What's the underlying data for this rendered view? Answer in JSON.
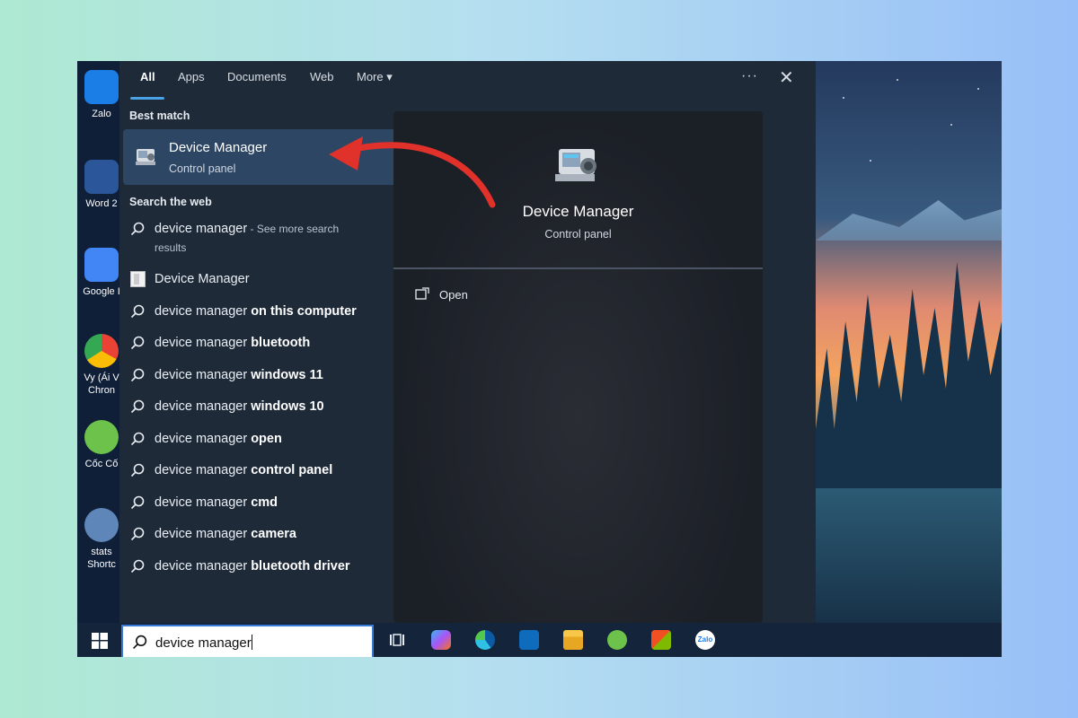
{
  "tabs": {
    "all": "All",
    "apps": "Apps",
    "documents": "Documents",
    "web": "Web",
    "more": "More",
    "more_caret": "▾",
    "options": "···",
    "close": "✕"
  },
  "best_match": {
    "heading": "Best match",
    "title": "Device Manager",
    "subtitle": "Control panel"
  },
  "search_web": {
    "heading": "Search the web",
    "first": {
      "query": "device manager",
      "suffix": " - See more search",
      "line2": "results"
    },
    "app_result": "Device Manager",
    "items": [
      {
        "base": "device manager",
        "bold": "on this computer"
      },
      {
        "base": "device manager",
        "bold": "bluetooth"
      },
      {
        "base": "device manager",
        "bold": "windows 11"
      },
      {
        "base": "device manager",
        "bold": "windows 10"
      },
      {
        "base": "device manager",
        "bold": "open"
      },
      {
        "base": "device manager",
        "bold": "control panel"
      },
      {
        "base": "device manager",
        "bold": "cmd"
      },
      {
        "base": "device manager",
        "bold": "camera"
      },
      {
        "base": "device manager",
        "bold": "bluetooth driver"
      }
    ],
    "chevron": "›"
  },
  "preview": {
    "title": "Device Manager",
    "subtitle": "Control panel",
    "open_label": "Open"
  },
  "taskbar": {
    "search_value": "device manager",
    "zalo_label": "Zalo"
  },
  "desktop": {
    "icons": [
      {
        "label": "Zalo",
        "icon": "zalo-icon"
      },
      {
        "label": "Word 2",
        "icon": "word-icon"
      },
      {
        "label": "Google I",
        "icon": "google-docs-icon"
      },
      {
        "label": "Vy (Ái V",
        "label2": "Chron",
        "icon": "chrome-icon"
      },
      {
        "label": "Cốc Cố",
        "icon": "coc-coc-icon"
      },
      {
        "label": "stats",
        "label2": "Shortc",
        "icon": "stats-shortcut-icon"
      }
    ]
  },
  "colors": {
    "accent": "#4aa2e6",
    "selected_bg": "#2d4663",
    "panel_bg": "#1e2a38",
    "annotation_arrow": "#e0312b"
  }
}
